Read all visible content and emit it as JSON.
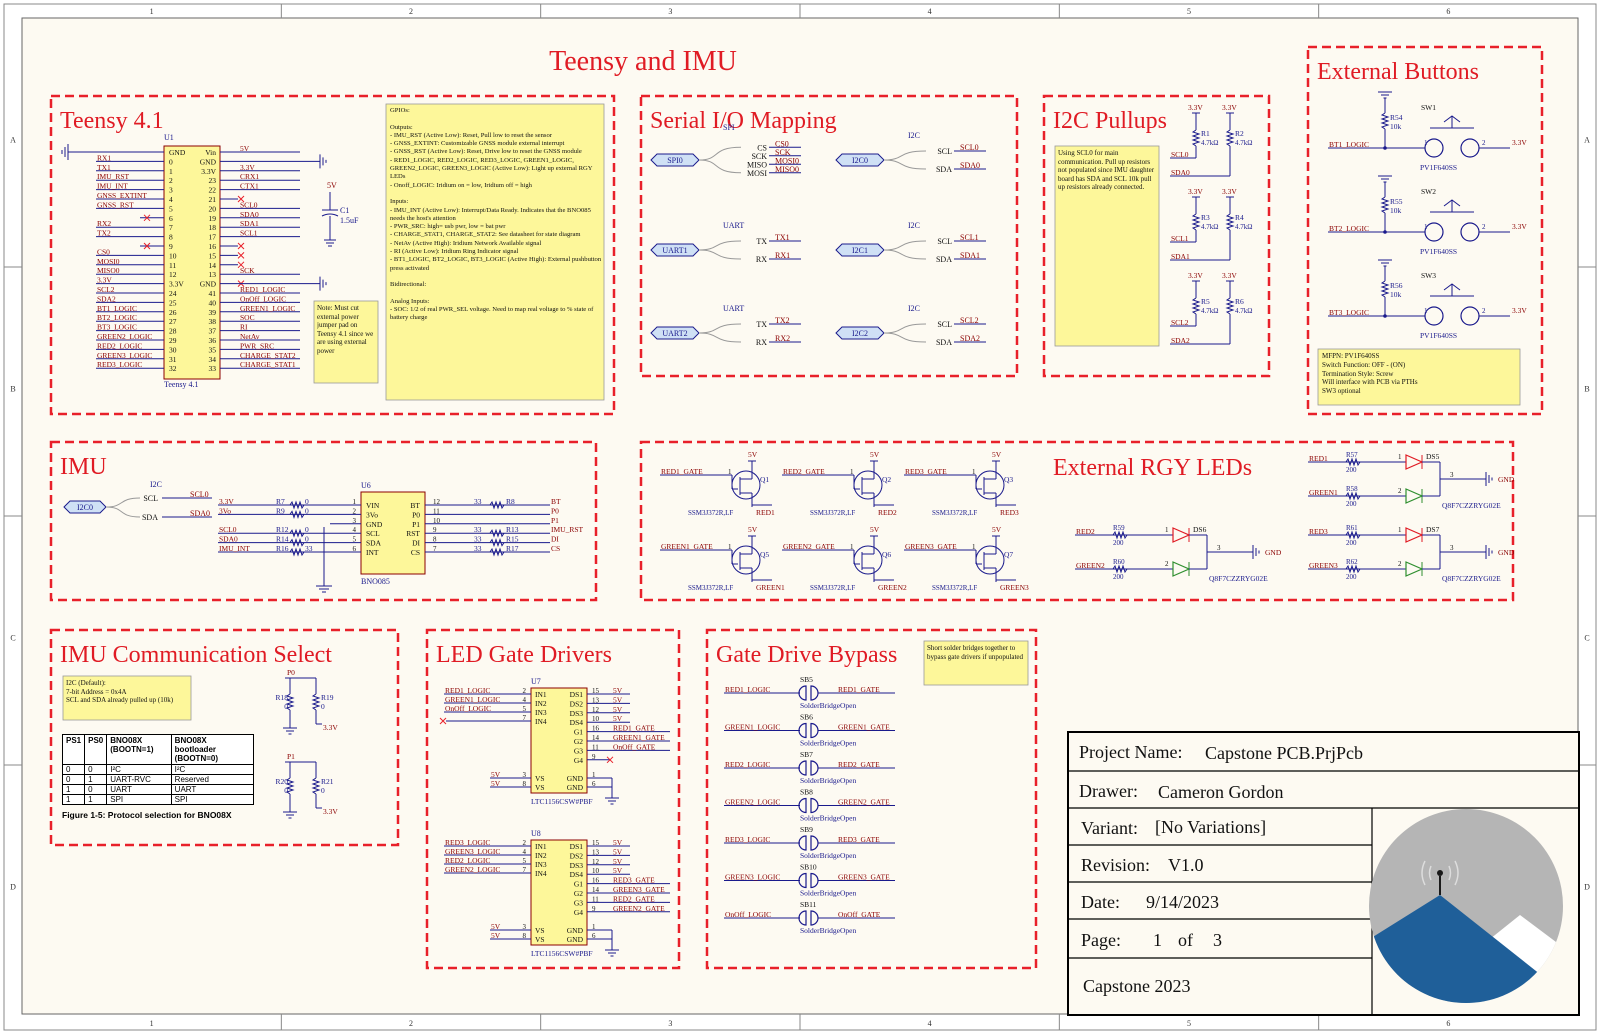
{
  "colors": {
    "sheet_bg": "#fdfaf2",
    "border_zone": "#eeeeee",
    "box_dash": "#e8202a",
    "title_red": "#e01b24",
    "wire": "#1a1a8c",
    "net_red": "#8b0000",
    "note_yellow": "#fdf79a",
    "logo_blue": "#1f5f99",
    "logo_grey": "#b5b5b5"
  },
  "border": {
    "cols": [
      "1",
      "2",
      "3",
      "4",
      "5",
      "6"
    ],
    "rows": [
      "A",
      "B",
      "C",
      "D"
    ]
  },
  "main_title": "Teensy and IMU",
  "teensy": {
    "title": "Teensy 4.1",
    "designator": "U1",
    "part": "Teensy 4.1",
    "left_nets": [
      "RX1",
      "TX1",
      "IMU_RST",
      "IMU_INT",
      "GNSS_EXTINT",
      "GNSS_RST",
      "",
      "RX2",
      "TX2",
      "",
      "CS0",
      "MOSI0",
      "MISO0",
      "3.3V",
      "SCL2",
      "SDA2",
      "BT1_LOGIC",
      "BT2_LOGIC",
      "BT3_LOGIC",
      "GREEN2_LOGIC",
      "RED2_LOGIC",
      "GREEN3_LOGIC",
      "RED3_LOGIC"
    ],
    "left_pins": [
      "GND",
      "0",
      "1",
      "2",
      "3",
      "4",
      "5",
      "6",
      "7",
      "8",
      "9",
      "10",
      "11",
      "12",
      "3.3V",
      "24",
      "25",
      "26",
      "27",
      "28",
      "29",
      "30",
      "31",
      "32"
    ],
    "right_pins": [
      "Vin",
      "GND",
      "3.3V",
      "23",
      "22",
      "21",
      "20",
      "19",
      "18",
      "17",
      "16",
      "15",
      "14",
      "13",
      "GND",
      "41",
      "40",
      "39",
      "38",
      "37",
      "36",
      "35",
      "34",
      "33"
    ],
    "right_nets": [
      "5V",
      "",
      "3.3V",
      "CRX1",
      "CTX1",
      "",
      "SCL0",
      "SDA0",
      "SDA1",
      "SCL1",
      "",
      "",
      "",
      "SCK",
      "",
      "RED1_LOGIC",
      "OnOff_LOGIC",
      "GREEN1_LOGIC",
      "SOC",
      "RI",
      "NetAv",
      "PWR_SRC",
      "CHARGE_STAT2",
      "CHARGE_STAT1"
    ],
    "cap_label": "C1",
    "cap_value": "1.5uF",
    "cap_rail": "5V",
    "note": "Note: Must cut external power jumper pad on Teensy 4.1 since we are using external power",
    "gpio_note": "GPIOs:\n\nOutputs:\n- IMU_RST (Active Low): Reset, Pull low to reset the sensor\n- GNSS_EXTINT: Customizable GNSS module external interrupt\n- GNSS_RST (Active Low): Reset, Drive low to reset the GNSS module\n- RED1_LOGIC, RED2_LOGIC, RED3_LOGIC, GREEN1_LOGIC, GREEN2_LOGIC, GREEN3_LOGIC (Active Low): Light up external RGY LEDs\n- Onoff_LOGIC: Iridium on = low, Iridium off = high\n\nInputs:\n- IMU_INT (Active Low): Interrupt/Data Ready. Indicates that the BNO085 needs the host's attention\n- PWR_SRC: high= usb pwr, low = bat pwr\n- CHARGE_STAT1, CHARGE_STAT2: See datasheet for state diagram\n- NetAv (Active High): Iridium Network Available signal\n- RI (Active Low): Iridium Ring Indicator signal\n- BT1_LOGIC, BT2_LOGIC, BT3_LOGIC (Active High): External pushbutton press activated\n\nBidirectional:\n\nAnalog Inputs:\n- SOC: 1/2 of real PWR_SEL voltage. Need to map real voltage to % state of battery charge"
  },
  "serial": {
    "title": "Serial I/O Mapping",
    "groups": [
      {
        "port": "SPI0",
        "bus": "SPI",
        "pins": [
          "CS",
          "SCK",
          "MISO",
          "MOSI"
        ],
        "nets": [
          "CS0",
          "SCK",
          "MOSI0",
          "MISO0"
        ]
      },
      {
        "port": "UART1",
        "bus": "UART",
        "pins": [
          "TX",
          "RX"
        ],
        "nets": [
          "TX1",
          "RX1"
        ]
      },
      {
        "port": "UART2",
        "bus": "UART",
        "pins": [
          "TX",
          "RX"
        ],
        "nets": [
          "TX2",
          "RX2"
        ]
      },
      {
        "port": "I2C0",
        "bus": "I2C",
        "pins": [
          "SCL",
          "SDA"
        ],
        "nets": [
          "SCL0",
          "SDA0"
        ]
      },
      {
        "port": "I2C1",
        "bus": "I2C",
        "pins": [
          "SCL",
          "SDA"
        ],
        "nets": [
          "SCL1",
          "SDA1"
        ]
      },
      {
        "port": "I2C2",
        "bus": "I2C",
        "pins": [
          "SCL",
          "SDA"
        ],
        "nets": [
          "SCL2",
          "SDA2"
        ]
      }
    ]
  },
  "pullups": {
    "title": "I2C Pullups",
    "note": "Using SCL0 for main communication. Pull up resistors not populated since IMU daughter board has SDA and SCL 10k pull up resistors already connected.",
    "rail": "3.3V",
    "value": "4.7kΩ",
    "pairs": [
      {
        "r1": "R1",
        "r2": "R2",
        "scl": "SCL0",
        "sda": "SDA0"
      },
      {
        "r1": "R3",
        "r2": "R4",
        "scl": "SCL1",
        "sda": "SDA1"
      },
      {
        "r1": "R5",
        "r2": "R6",
        "scl": "SCL2",
        "sda": "SDA2"
      }
    ]
  },
  "buttons": {
    "title": "External Buttons",
    "items": [
      {
        "sw": "SW1",
        "r": "R54",
        "net": "BT1_LOGIC"
      },
      {
        "sw": "SW2",
        "r": "R55",
        "net": "BT2_LOGIC"
      },
      {
        "sw": "SW3",
        "r": "R56",
        "net": "BT3_LOGIC"
      }
    ],
    "rvalue": "10k",
    "part": "PV1F640SS",
    "rail": "3.3V",
    "pin1": "1",
    "pin2": "2",
    "note": "MFPN: PV1F640SS\nSwitch Function: OFF - (ON)\nTermination Style: Screw\nWill interface with PCB via PTHs\nSW3 optional"
  },
  "imu": {
    "title": "IMU",
    "port": "I2C0",
    "bus": "I2C",
    "pins": [
      "SCL",
      "SDA"
    ],
    "nets": [
      "SCL0",
      "SDA0"
    ],
    "designator": "U6",
    "part": "BNO085",
    "left_pins": [
      "VIN",
      "3Vo",
      "GND",
      "SCL",
      "SDA",
      "INT"
    ],
    "left_nums": [
      "1",
      "2",
      "3",
      "4",
      "5",
      "6"
    ],
    "right_pins": [
      "BT",
      "P0",
      "P1",
      "RST",
      "DI",
      "CS"
    ],
    "right_nums": [
      "12",
      "11",
      "10",
      "9",
      "8",
      "7"
    ],
    "left_nets": [
      "3.3V",
      "3Vo",
      "",
      "SCL0",
      "SDA0",
      "IMU_INT"
    ],
    "left_res": [
      "R7",
      "R9",
      "",
      "R12",
      "R14",
      "R16"
    ],
    "left_vals": [
      "0",
      "0",
      "",
      "0",
      "0",
      "33"
    ],
    "right_res": [
      "R8",
      "",
      "",
      "R13",
      "R15",
      "R17"
    ],
    "right_vals": [
      "33",
      "",
      "",
      "33",
      "33",
      "33"
    ],
    "right_nets": [
      "BT",
      "P0",
      "P1",
      "IMU_RST",
      "DI",
      "CS"
    ]
  },
  "rgy": {
    "title": "External RGY LEDs",
    "fets": [
      {
        "q": "Q1",
        "gate": "RED1_GATE",
        "out": "RED1"
      },
      {
        "q": "Q2",
        "gate": "RED2_GATE",
        "out": "RED2"
      },
      {
        "q": "Q3",
        "gate": "RED3_GATE",
        "out": "RED3"
      },
      {
        "q": "Q5",
        "gate": "GREEN1_GATE",
        "out": "GREEN1"
      },
      {
        "q": "Q6",
        "gate": "GREEN2_GATE",
        "out": "GREEN2"
      },
      {
        "q": "Q7",
        "gate": "GREEN3_GATE",
        "out": "GREEN3"
      }
    ],
    "fet_part": "SSM3J372R,LF",
    "rail": "5V",
    "led_part": "Q8F7CZZRYG02E",
    "gnd": "GND",
    "res_value": "200",
    "leds": [
      {
        "ds": "DS5",
        "r_red": "R57",
        "r_green": "R58",
        "red": "RED1",
        "green": "GREEN1"
      },
      {
        "ds": "DS6",
        "r_red": "R59",
        "r_green": "R60",
        "red": "RED2",
        "green": "GREEN2"
      },
      {
        "ds": "DS7",
        "r_red": "R61",
        "r_green": "R62",
        "red": "RED3",
        "green": "GREEN3"
      }
    ]
  },
  "comm": {
    "title": "IMU Communication Select",
    "note": "I2C (Default):\n7-bit Address = 0x4A\nSCL and SDA already pulled up (10k)",
    "table_headers": [
      "PS1",
      "PS0",
      "BNO08X (BOOTN=1)",
      "BNO08X bootloader (BOOTN=0)"
    ],
    "table_rows": [
      [
        "0",
        "0",
        "I²C",
        "I²C"
      ],
      [
        "0",
        "1",
        "UART-RVC",
        "Reserved"
      ],
      [
        "1",
        "0",
        "UART",
        "UART"
      ],
      [
        "1",
        "1",
        "SPI",
        "SPI"
      ]
    ],
    "caption": "Figure 1-5:  Protocol selection for BNO08X",
    "resistors": [
      {
        "net": "P0",
        "ra": "R18",
        "rb": "R19"
      },
      {
        "net": "P1",
        "ra": "R20",
        "rb": "R21"
      }
    ],
    "rvalue": "0",
    "rail": "3.3V"
  },
  "drivers": {
    "title": "LED Gate Drivers",
    "chips": [
      {
        "designator": "U7",
        "inputs": [
          "RED1_LOGIC",
          "GREEN1_LOGIC",
          "OnOff_LOGIC",
          ""
        ],
        "outputs": [
          "RED1_GATE",
          "GREEN1_GATE",
          "OnOff_GATE",
          ""
        ]
      },
      {
        "designator": "U8",
        "inputs": [
          "RED3_LOGIC",
          "GREEN3_LOGIC",
          "RED2_LOGIC",
          "GREEN2_LOGIC"
        ],
        "outputs": [
          "RED3_GATE",
          "GREEN3_GATE",
          "RED2_GATE",
          "GREEN2_GATE"
        ]
      }
    ],
    "part": "LTC1156CSW#PBF",
    "in_pins": [
      "IN1",
      "IN2",
      "IN3",
      "IN4"
    ],
    "in_nums": [
      "2",
      "4",
      "5",
      "7"
    ],
    "right_pins": [
      "DS1",
      "DS2",
      "DS3",
      "DS4",
      "G1",
      "G2",
      "G3",
      "G4"
    ],
    "right_nums": [
      "15",
      "13",
      "12",
      "10",
      "16",
      "14",
      "11",
      "9"
    ],
    "ds_nets": [
      "5V",
      "5V",
      "5V",
      "5V"
    ],
    "vs_pins": [
      "VS",
      "VS"
    ],
    "vs_nums": [
      "3",
      "8"
    ],
    "gnd_pins": [
      "GND",
      "GND"
    ],
    "gnd_nums": [
      "1",
      "6"
    ],
    "vs_net": "5V"
  },
  "bypass": {
    "title": "Gate Drive Bypass",
    "note": "Short solder bridges together to bypass gate drivers if unpopulated",
    "part": "SolderBridgeOpen",
    "bridges": [
      {
        "sb": "SB5",
        "in": "RED1_LOGIC",
        "out": "RED1_GATE"
      },
      {
        "sb": "SB6",
        "in": "GREEN1_LOGIC",
        "out": "GREEN1_GATE"
      },
      {
        "sb": "SB7",
        "in": "RED2_LOGIC",
        "out": "RED2_GATE"
      },
      {
        "sb": "SB8",
        "in": "GREEN2_LOGIC",
        "out": "GREEN2_GATE"
      },
      {
        "sb": "SB9",
        "in": "RED3_LOGIC",
        "out": "RED3_GATE"
      },
      {
        "sb": "SB10",
        "in": "GREEN3_LOGIC",
        "out": "GREEN3_GATE"
      },
      {
        "sb": "SB11",
        "in": "OnOff_LOGIC",
        "out": "OnOff_GATE"
      }
    ]
  },
  "title_block": {
    "project_label": "Project Name:",
    "project": "Capstone PCB.PrjPcb",
    "drawer_label": "Drawer:",
    "drawer": "Cameron Gordon",
    "variant_label": "Variant:",
    "variant": "[No Variations]",
    "revision_label": "Revision:",
    "revision": "V1.0",
    "date_label": "Date:",
    "date": "9/14/2023",
    "page_label": "Page:",
    "page": "1",
    "of_label": "of",
    "pages": "3",
    "footer": "Capstone 2023"
  }
}
